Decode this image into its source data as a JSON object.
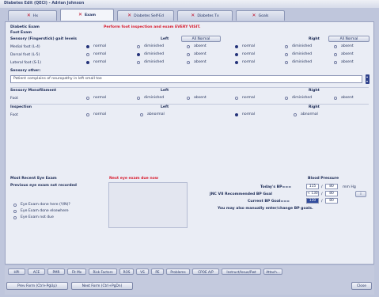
{
  "window": {
    "title": "Diabetes Edit (QECI) - Adrian Johnson"
  },
  "tabs": [
    {
      "label": "Hx",
      "active": false
    },
    {
      "label": "Exam",
      "active": true
    },
    {
      "label": "Diabetes Self-Ed",
      "active": false
    },
    {
      "label": "Diabetes Tx",
      "active": false
    },
    {
      "label": "Goals",
      "active": false
    }
  ],
  "exam": {
    "section_title": "Diabetic Exam",
    "notice": "Perform foot inspection and exam EVERY VISIT.",
    "subsection": "Foot Exam",
    "sensory_header": "Sensory (Fingerstick) gait levels",
    "left_header": "Left",
    "right_header": "Right",
    "all_normal_left": "All Normal",
    "all_normal_right": "All Normal",
    "rows": [
      {
        "label": "Medial foot (L-4)",
        "left": [
          "normal",
          "diminished",
          "absent"
        ],
        "left_sel": 0,
        "right": [
          "normal",
          "diminished",
          "absent"
        ],
        "right_sel": 0
      },
      {
        "label": "Dorsal foot (L-5)",
        "left": [
          "normal",
          "diminished",
          "absent"
        ],
        "left_sel": 1,
        "right": [
          "normal",
          "diminished",
          "absent"
        ],
        "right_sel": 0
      },
      {
        "label": "Lateral foot (S-1)",
        "left": [
          "normal",
          "diminished",
          "absent"
        ],
        "left_sel": 0,
        "right": [
          "normal",
          "diminished",
          "absent"
        ],
        "right_sel": 0
      }
    ],
    "sensory_other_label": "Sensory other:",
    "sensory_other_value": "Patient complains of neuropathy in left small toe",
    "monofilament_header": "Sensory Monofilament",
    "monofilament_row": {
      "label": "Foot",
      "left": [
        "normal",
        "diminished",
        "absent"
      ],
      "left_sel": -1,
      "right": [
        "normal",
        "diminished",
        "absent"
      ],
      "right_sel": -1
    },
    "inspection_header": "Inspection",
    "inspection_row": {
      "label": "Foot",
      "left": [
        "normal",
        "abnormal"
      ],
      "left_sel": -1,
      "right": [
        "normal",
        "abnormal"
      ],
      "right_sel": 0
    }
  },
  "eye": {
    "title": "Most Recent Eye Exam",
    "due": "Next eye exam due now",
    "subtitle": "Previous eye exam not recorded",
    "options": [
      "Eye Exam done here (Y/N)?",
      "Eye Exam done elsewhere",
      "Eye Exam not due"
    ]
  },
  "bp": {
    "title": "Blood Pressure",
    "today_label": "Today's BP===",
    "today_sys": "115",
    "today_dia": "80",
    "today_unit": "mm Hg",
    "jnc_label": "JNC VII Recommended BP Goal",
    "jnc_sys": "< 130",
    "jnc_dia": "80",
    "current_label": "Current BP Goal===",
    "current_sys": "130",
    "current_dia": "80",
    "note": "You may also manually enter/change BP goals.",
    "separator": "/"
  },
  "toolbar": [
    "HPI",
    "ACE",
    "PMR",
    "Fit Mx",
    "Risk Factors",
    "ROS",
    "VS",
    "PE",
    "Problems",
    "CPOE A/P",
    "Instruct/Issue/Pwt",
    "Attach..."
  ],
  "nav": {
    "prev": "Prev Form (Ctrl+PgUp)",
    "next": "Next Form (Ctrl+PgDn)",
    "close": "Close"
  },
  "colors": {
    "accent": "#24337a",
    "alert": "#d81b2d",
    "panel": "#eaedf5"
  }
}
